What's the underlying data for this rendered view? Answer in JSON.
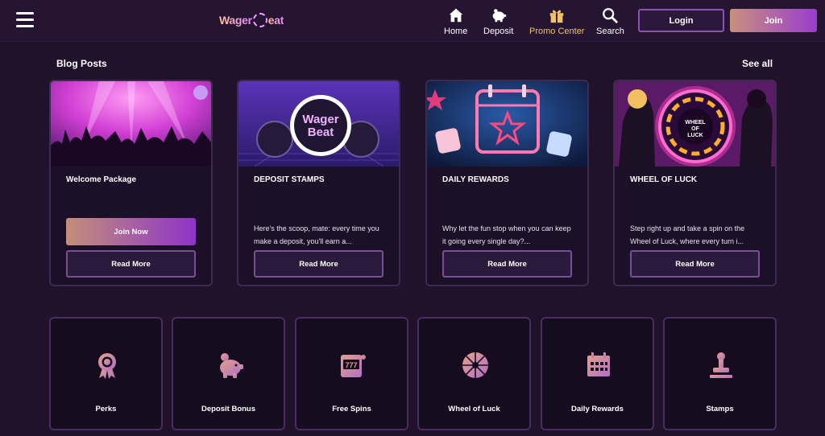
{
  "header": {
    "logo_text": "WagerBeat",
    "logo_part1": "Wager",
    "logo_part2": "eat",
    "nav": [
      {
        "label": "Home",
        "icon": "home-icon"
      },
      {
        "label": "Deposit",
        "icon": "piggy-bank-icon"
      },
      {
        "label": "Promo Center",
        "icon": "gift-icon",
        "active": true
      },
      {
        "label": "Search",
        "icon": "search-icon"
      }
    ],
    "login_label": "Login",
    "join_label": "Join"
  },
  "blog": {
    "title": "Blog Posts",
    "see_all": "See all",
    "cards": [
      {
        "title": "Welcome Package",
        "description": "",
        "primary_button": "Join Now",
        "secondary_button": "Read More"
      },
      {
        "title": "DEPOSIT STAMPS",
        "description": "Here's the scoop, mate: every time you make a deposit, you'll earn a...",
        "secondary_button": "Read More"
      },
      {
        "title": "DAILY REWARDS",
        "description": "Why let the fun stop when you can keep it going every single day?...",
        "secondary_button": "Read More"
      },
      {
        "title": "WHEEL OF LUCK",
        "description": "Step right up and take a spin on the Wheel of Luck, where every turn i...",
        "secondary_button": "Read More"
      }
    ]
  },
  "promos": [
    {
      "label": "Perks",
      "icon": "ribbon-award-icon"
    },
    {
      "label": "Deposit Bonus",
      "icon": "piggy-bank-icon"
    },
    {
      "label": "Free Spins",
      "icon": "slot-machine-icon"
    },
    {
      "label": "Wheel of Luck",
      "icon": "wheel-icon"
    },
    {
      "label": "Daily Rewards",
      "icon": "calendar-icon"
    },
    {
      "label": "Stamps",
      "icon": "stamp-icon"
    }
  ],
  "colors": {
    "background": "#21122c",
    "header": "#251532",
    "accent_active": "#f1c26a",
    "join_gradient_start": "#c9907d",
    "join_gradient_end": "#9a3dcd",
    "icon_gradient_start": "#e5a08a",
    "icon_gradient_end": "#b070c4"
  }
}
